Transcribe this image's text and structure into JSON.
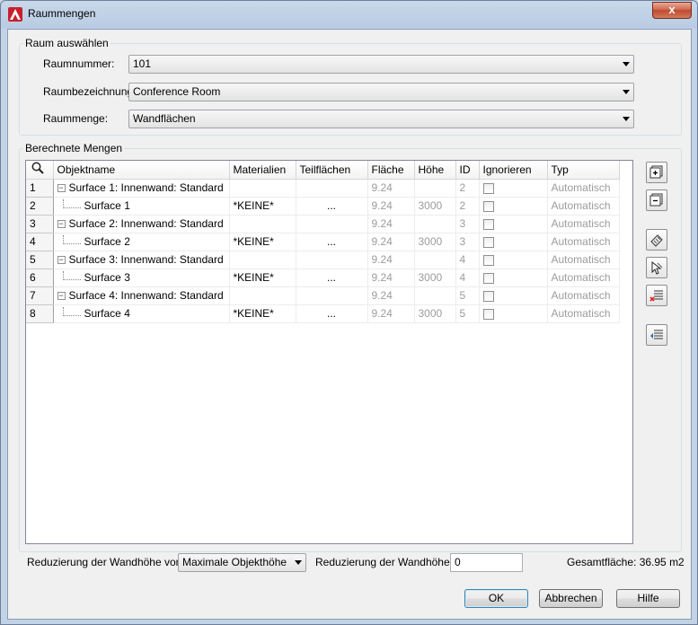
{
  "window": {
    "title": "Raummengen",
    "close_label": "x"
  },
  "raum": {
    "group_label": "Raum auswählen",
    "raumnummer_label": "Raumnummer:",
    "raumnummer_value": "101",
    "raumbezeichnung_label": "Raumbezeichnung:",
    "raumbezeichnung_value": "Conference Room",
    "raummenge_label": "Raummenge:",
    "raummenge_value": "Wandflächen"
  },
  "mengen": {
    "group_label": "Berechnete Mengen",
    "columns": [
      "Objektname",
      "Materialien",
      "Teilflächen",
      "Fläche",
      "Höhe",
      "ID",
      "Ignorieren",
      "Typ"
    ],
    "rows": [
      {
        "num": "1",
        "name": "Surface 1: Innenwand: Standard",
        "parent": true,
        "material": "",
        "teil": "",
        "flaeche": "9.24",
        "hoehe": "",
        "id": "2",
        "typ": "Automatisch"
      },
      {
        "num": "2",
        "name": "Surface 1",
        "parent": false,
        "material": "*KEINE*",
        "teil": "...",
        "flaeche": "9.24",
        "hoehe": "3000",
        "id": "2",
        "typ": "Automatisch"
      },
      {
        "num": "3",
        "name": "Surface 2: Innenwand: Standard",
        "parent": true,
        "material": "",
        "teil": "",
        "flaeche": "9.24",
        "hoehe": "",
        "id": "3",
        "typ": "Automatisch"
      },
      {
        "num": "4",
        "name": "Surface 2",
        "parent": false,
        "material": "*KEINE*",
        "teil": "...",
        "flaeche": "9.24",
        "hoehe": "3000",
        "id": "3",
        "typ": "Automatisch"
      },
      {
        "num": "5",
        "name": "Surface 3: Innenwand: Standard",
        "parent": true,
        "material": "",
        "teil": "",
        "flaeche": "9.24",
        "hoehe": "",
        "id": "4",
        "typ": "Automatisch"
      },
      {
        "num": "6",
        "name": "Surface 3",
        "parent": false,
        "material": "*KEINE*",
        "teil": "...",
        "flaeche": "9.24",
        "hoehe": "3000",
        "id": "4",
        "typ": "Automatisch"
      },
      {
        "num": "7",
        "name": "Surface 4: Innenwand: Standard",
        "parent": true,
        "material": "",
        "teil": "",
        "flaeche": "9.24",
        "hoehe": "",
        "id": "5",
        "typ": "Automatisch"
      },
      {
        "num": "8",
        "name": "Surface 4",
        "parent": false,
        "material": "*KEINE*",
        "teil": "...",
        "flaeche": "9.24",
        "hoehe": "3000",
        "id": "5",
        "typ": "Automatisch"
      }
    ]
  },
  "side_icons": [
    "expand-all-icon",
    "collapse-all-icon",
    "select-object-icon",
    "pick-object-icon",
    "remove-list-icon",
    "add-list-icon"
  ],
  "bottom": {
    "wandhoehe_von_label": "Reduzierung der Wandhöhe von",
    "wandhoehe_von_value": "Maximale Objekthöhe",
    "wandhoehe_label": "Reduzierung der Wandhöhe",
    "wandhoehe_value": "0",
    "gesamtflaeche": "Gesamtfläche: 36.95 m2"
  },
  "buttons": {
    "ok": "OK",
    "cancel": "Abbrechen",
    "help": "Hilfe"
  }
}
